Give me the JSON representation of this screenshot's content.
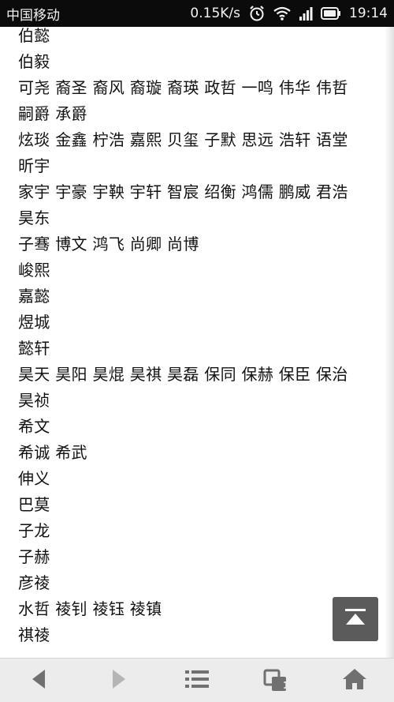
{
  "status_bar": {
    "carrier": "中国移动",
    "network_speed": "0.15K/s",
    "time": "19:14",
    "icons": [
      "alarm-icon",
      "wifi-icon",
      "signal-icon",
      "battery-icon"
    ]
  },
  "names": [
    "伯懿",
    "伯毅",
    "可尧 裔圣 裔风 裔璇 裔瑛 政哲 一鸣 伟华 伟哲",
    "嗣爵 承爵",
    "炫琰 金鑫 柠浩 嘉熙 贝玺 子默 思远 浩轩 语堂",
    "昕宇",
    "家宇 宇豪 宇鞅 宇轩 智宸 绍衡 鸿儒 鹏威 君浩",
    "昊东",
    "子骞 博文 鸿飞 尚卿 尚博",
    "峻熙",
    "嘉懿",
    "煜城",
    "懿轩",
    "昊天 昊阳 昊焜 昊祺 昊磊 保同 保赫 保臣 保治",
    "昊祯",
    "希文",
    "希诚 希武",
    "伸义",
    "巴莫",
    "子龙",
    "子赫",
    "彦祾",
    "水哲 祾钊 祾钰 祾镇",
    "祺祾"
  ],
  "back_to_top_icon": "back-to-top-icon",
  "bottom_nav": {
    "items": [
      "back-arrow-icon",
      "forward-arrow-icon",
      "menu-icon",
      "tabs-icon",
      "home-icon"
    ],
    "tab_count": "1"
  },
  "colors": {
    "status_bar": "#0b0b0b",
    "text": "#111111",
    "nav_bar": "#ececec",
    "nav_icon": "#707070",
    "nav_icon_disabled": "#b5b5b5",
    "back_to_top": "#5b5b5b"
  }
}
